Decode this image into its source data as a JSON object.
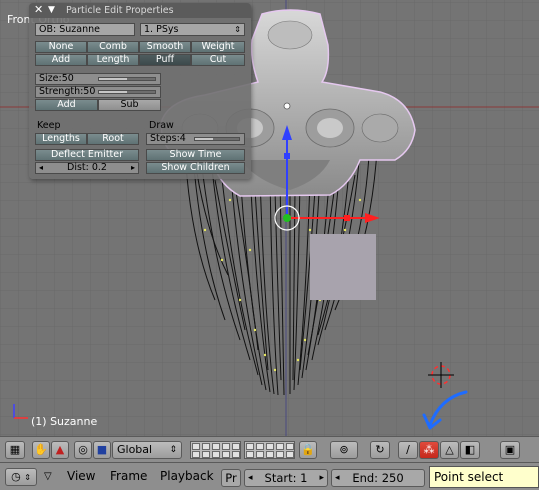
{
  "viewport": {
    "view_name": "Front Ortho",
    "object_label": "(1) Suzanne"
  },
  "panel": {
    "title": "Particle Edit Properties",
    "object_field": "OB: Suzanne",
    "psys_field": "1. PSys",
    "brush_row1": [
      "None",
      "Comb",
      "Smooth",
      "Weight"
    ],
    "brush_row2": [
      "Add",
      "Length",
      "Puff",
      "Cut"
    ],
    "size_label": "Size:50",
    "size_fraction": 0.5,
    "strength_label": "Strength:50",
    "strength_fraction": 0.5,
    "add_label": "Add",
    "sub_label": "Sub",
    "keep_label": "Keep",
    "draw_label": "Draw",
    "lengths_label": "Lengths",
    "root_label": "Root",
    "steps_label": "Steps:4",
    "steps_fraction": 0.4,
    "deflect_label": "Deflect Emitter",
    "show_time_label": "Show Time",
    "dist_label": "Dist: 0.2",
    "show_children_label": "Show Children"
  },
  "header": {
    "orientation": "Global"
  },
  "timeline": {
    "view_menu": "View",
    "frame_menu": "Frame",
    "playback_menu": "Playback",
    "pr_field": "Pr",
    "start_field": "Start: 1",
    "end_field": "End: 250"
  },
  "tooltip": {
    "text": "Point select mode"
  },
  "colors": {
    "viewport_bg": "#747474",
    "grid_line": "#6a6a6a",
    "axis_red": "#8a3a3a",
    "axis_blue": "#4a4a80",
    "selected_mode": "#d63a2c",
    "annotation_arrow": "#1e6cff"
  }
}
